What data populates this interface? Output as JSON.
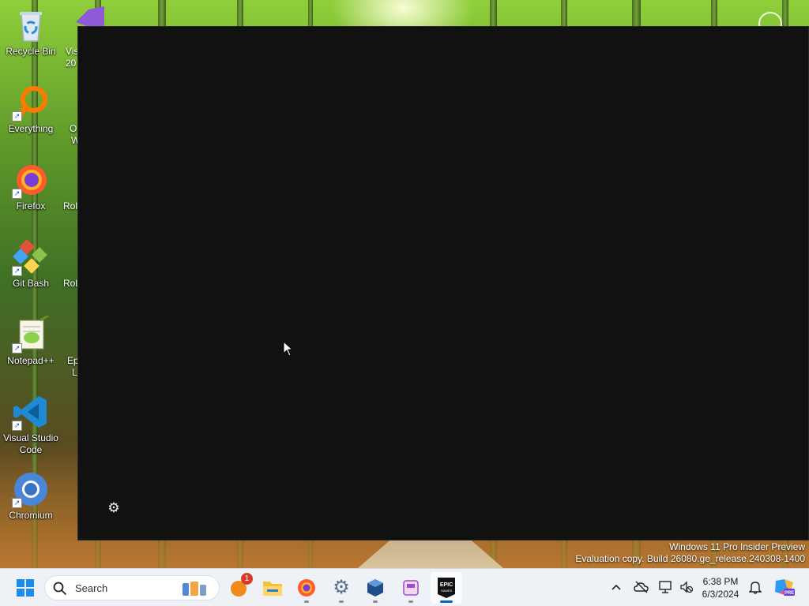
{
  "desktop": {
    "icons": [
      {
        "label": "Recycle Bin"
      },
      {
        "label": "Everything"
      },
      {
        "label": "Firefox"
      },
      {
        "label": "Git Bash"
      },
      {
        "label": "Notepad++"
      },
      {
        "label": "Visual Studio Code"
      },
      {
        "label": "Chromium"
      }
    ],
    "partial_labels": [
      "Vis",
      "20",
      "O",
      "W",
      "Rol",
      "Rol",
      "Ep",
      "L"
    ]
  },
  "watermark": {
    "line1": "Windows 11 Pro Insider Preview",
    "line2": "Evaluation copy. Build 26080.ge_release.240308-1400"
  },
  "taskbar": {
    "search_placeholder": "Search",
    "notification_badge": "1",
    "clock_time": "6:38 PM",
    "clock_date": "6/3/2024",
    "epic_label": "EPIC",
    "epic_sublabel": "GAMES",
    "copilot_badge": "PRE"
  },
  "colors": {
    "window_bg": "#111112",
    "taskbar_bg": "#eef2f6",
    "accent": "#0067c0"
  }
}
